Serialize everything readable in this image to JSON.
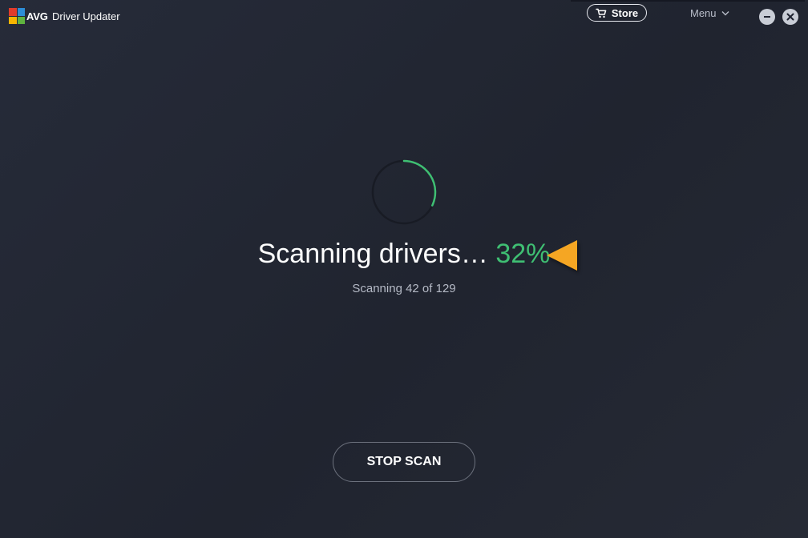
{
  "app": {
    "brand": "AVG",
    "title": "Driver Updater",
    "logo_colors": [
      "#e13b2b",
      "#2d8dd6",
      "#f7b500",
      "#5fb33f"
    ]
  },
  "header": {
    "store_label": "Store",
    "store_icon": "cart-icon",
    "menu_label": "Menu",
    "menu_icon": "chevron-down-icon",
    "window_controls": [
      "minimize-icon",
      "close-icon"
    ]
  },
  "scan": {
    "status_text": "Scanning drivers…",
    "percent_label": "32%",
    "progress": 0.32,
    "detail_text": "Scanning 42 of 129",
    "pointer_icon": "arrow-left-icon",
    "pointer_color": "#f5a623"
  },
  "actions": {
    "stop_label": "STOP SCAN"
  },
  "colors": {
    "accent": "#3fbf73",
    "background": "#232734",
    "ring_track": "#181b24"
  }
}
